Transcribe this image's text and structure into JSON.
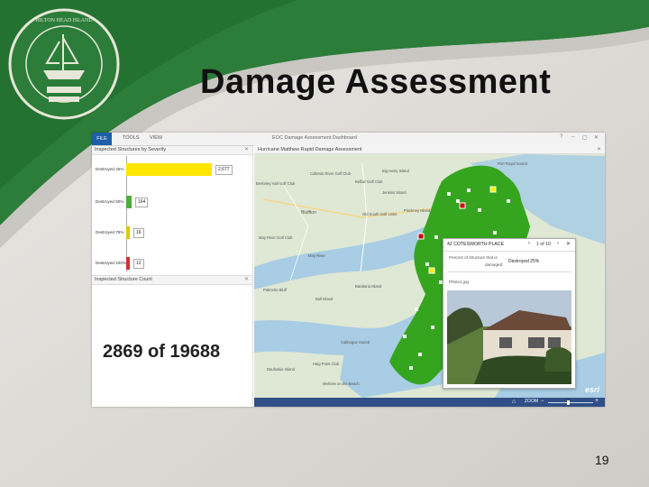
{
  "slide": {
    "title": "Damage Assessment",
    "page_number": "19",
    "seal_text": "TOWN OF HILTON HEAD ISLAND SOUTH CAROLINA",
    "seal_motto": "PARADISE · HOPE",
    "seal_years": "1663 · 1983"
  },
  "app": {
    "window_title": "EOC Damage Assessment Dashboard",
    "ribbon_tabs": [
      "FILE",
      "TOOLS",
      "VIEW"
    ],
    "window_controls": [
      "?",
      "–",
      "▢",
      "✕"
    ]
  },
  "severity_panel": {
    "title": "Inspected Structures by Severity",
    "close": "✕",
    "bars": [
      {
        "label": "Destroyed 25%",
        "value": "2,677",
        "amount": 2677,
        "color": "#ffe600"
      },
      {
        "label": "Destroyed 50%",
        "value": "164",
        "amount": 164,
        "color": "#4caf3c"
      },
      {
        "label": "Destroyed 75%",
        "value": "16",
        "amount": 16,
        "color": "#e0c800"
      },
      {
        "label": "Destroyed 100%",
        "value": "12",
        "amount": 12,
        "color": "#d32f2f"
      }
    ]
  },
  "count_panel": {
    "title": "Inspected Structure Count",
    "close": "✕",
    "count_text": "2869 of 19688"
  },
  "map": {
    "title": "Hurricane Matthew Rapid Damage Assessment",
    "close": "✕",
    "zoom_label": "ZOOM",
    "home_icon": "home-icon",
    "places": [
      "Colleton River Golf Club",
      "Belfair Golf Club",
      "Berkeley Hall Golf Club",
      "Bluffton",
      "Old South Golf Links",
      "May River Golf Club",
      "May River",
      "Palmetto Bluff",
      "Bull Island",
      "Daufuskie Island",
      "Haig Point Club",
      "Melrose on the Beach",
      "Jenkins Island",
      "Pinckney Island",
      "Big Harry Island",
      "Calibogue Sound",
      "Barataria Island",
      "Port Royal Sound"
    ],
    "popup": {
      "title": "42 COTESWORTH PLACE",
      "pager": "1 of 10",
      "close": "✕",
      "field_label": "Percent of structure that is damaged:",
      "field_label_line1": "Percent of structure that is",
      "field_label_line2": "damaged:",
      "field_value": "Destroyed 25%",
      "photo_caption": "Photo1.jpg"
    },
    "logo": "esri"
  }
}
